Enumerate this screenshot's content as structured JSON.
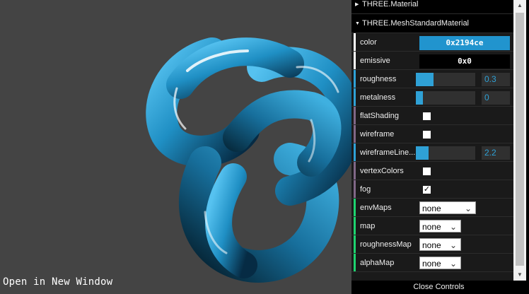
{
  "link": {
    "open_new_window": "Open in New Window"
  },
  "gui": {
    "folder_material": "THREE.Material",
    "folder_standard": "THREE.MeshStandardMaterial",
    "close_controls": "Close Controls"
  },
  "controls": {
    "color": {
      "label": "color",
      "value": "0x2194ce",
      "swatch": "#2194ce"
    },
    "emissive": {
      "label": "emissive",
      "value": "0x0",
      "swatch": "#000000"
    },
    "roughness": {
      "label": "roughness",
      "value": "0.3",
      "fraction": 0.3
    },
    "metalness": {
      "label": "metalness",
      "value": "0",
      "fraction": 0.0
    },
    "flatShading": {
      "label": "flatShading",
      "checked": false
    },
    "wireframe": {
      "label": "wireframe",
      "checked": false
    },
    "wireframeLinewidth": {
      "label": "wireframeLine...",
      "value": "2.2",
      "fraction": 0.22
    },
    "vertexColors": {
      "label": "vertexColors",
      "checked": false
    },
    "fog": {
      "label": "fog",
      "checked": true
    },
    "envMaps": {
      "label": "envMaps",
      "value": "none"
    },
    "map": {
      "label": "map",
      "value": "none"
    },
    "roughnessMap": {
      "label": "roughnessMap",
      "value": "none"
    },
    "alphaMap": {
      "label": "alphaMap",
      "value": "none"
    }
  },
  "colors": {
    "background": "#444444",
    "mesh": "#2194ce",
    "slider_accent": "#2fa1d6"
  }
}
